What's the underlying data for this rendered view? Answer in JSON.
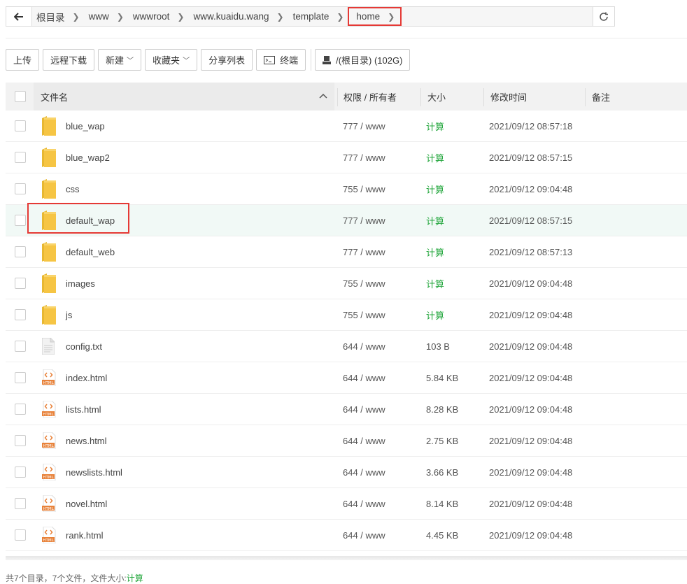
{
  "breadcrumb": {
    "items": [
      {
        "label": "根目录"
      },
      {
        "label": "www"
      },
      {
        "label": "wwwroot"
      },
      {
        "label": "www.kuaidu.wang"
      },
      {
        "label": "template"
      },
      {
        "label": "home"
      }
    ]
  },
  "toolbar": {
    "upload": "上传",
    "remote_download": "远程下载",
    "new": "新建",
    "favorites": "收藏夹",
    "share_list": "分享列表",
    "terminal": "终端",
    "disk": "/(根目录) (102G)"
  },
  "table": {
    "headers": {
      "name": "文件名",
      "perm": "权限 / 所有者",
      "size": "大小",
      "mtime": "修改时间",
      "note": "备注"
    },
    "rows": [
      {
        "name": "blue_wap",
        "type": "folder",
        "perm": "777 / www",
        "size": "计算",
        "mtime": "2021/09/12 08:57:18",
        "note": ""
      },
      {
        "name": "blue_wap2",
        "type": "folder",
        "perm": "777 / www",
        "size": "计算",
        "mtime": "2021/09/12 08:57:15",
        "note": ""
      },
      {
        "name": "css",
        "type": "folder",
        "perm": "755 / www",
        "size": "计算",
        "mtime": "2021/09/12 09:04:48",
        "note": ""
      },
      {
        "name": "default_wap",
        "type": "folder",
        "perm": "777 / www",
        "size": "计算",
        "mtime": "2021/09/12 08:57:15",
        "note": ""
      },
      {
        "name": "default_web",
        "type": "folder",
        "perm": "777 / www",
        "size": "计算",
        "mtime": "2021/09/12 08:57:13",
        "note": ""
      },
      {
        "name": "images",
        "type": "folder",
        "perm": "755 / www",
        "size": "计算",
        "mtime": "2021/09/12 09:04:48",
        "note": ""
      },
      {
        "name": "js",
        "type": "folder",
        "perm": "755 / www",
        "size": "计算",
        "mtime": "2021/09/12 09:04:48",
        "note": ""
      },
      {
        "name": "config.txt",
        "type": "txt",
        "perm": "644 / www",
        "size": "103 B",
        "mtime": "2021/09/12 09:04:48",
        "note": ""
      },
      {
        "name": "index.html",
        "type": "html",
        "perm": "644 / www",
        "size": "5.84 KB",
        "mtime": "2021/09/12 09:04:48",
        "note": ""
      },
      {
        "name": "lists.html",
        "type": "html",
        "perm": "644 / www",
        "size": "8.28 KB",
        "mtime": "2021/09/12 09:04:48",
        "note": ""
      },
      {
        "name": "news.html",
        "type": "html",
        "perm": "644 / www",
        "size": "2.75 KB",
        "mtime": "2021/09/12 09:04:48",
        "note": ""
      },
      {
        "name": "newslists.html",
        "type": "html",
        "perm": "644 / www",
        "size": "3.66 KB",
        "mtime": "2021/09/12 09:04:48",
        "note": ""
      },
      {
        "name": "novel.html",
        "type": "html",
        "perm": "644 / www",
        "size": "8.14 KB",
        "mtime": "2021/09/12 09:04:48",
        "note": ""
      },
      {
        "name": "rank.html",
        "type": "html",
        "perm": "644 / www",
        "size": "4.45 KB",
        "mtime": "2021/09/12 09:04:48",
        "note": ""
      }
    ]
  },
  "icons": {
    "folder": "folder-icon",
    "txt": "text-file-icon",
    "html": "html-file-icon",
    "back": "back-arrow-icon",
    "refresh": "refresh-icon",
    "terminal": "terminal-icon",
    "disk": "disk-icon",
    "sort": "sort-asc-icon"
  },
  "colors": {
    "green": "#20a53a",
    "highlight": "#e53935",
    "folder": "#f6c544"
  },
  "status": {
    "text": "共7个目录，7个文件，文件大小:",
    "link": "计算"
  }
}
